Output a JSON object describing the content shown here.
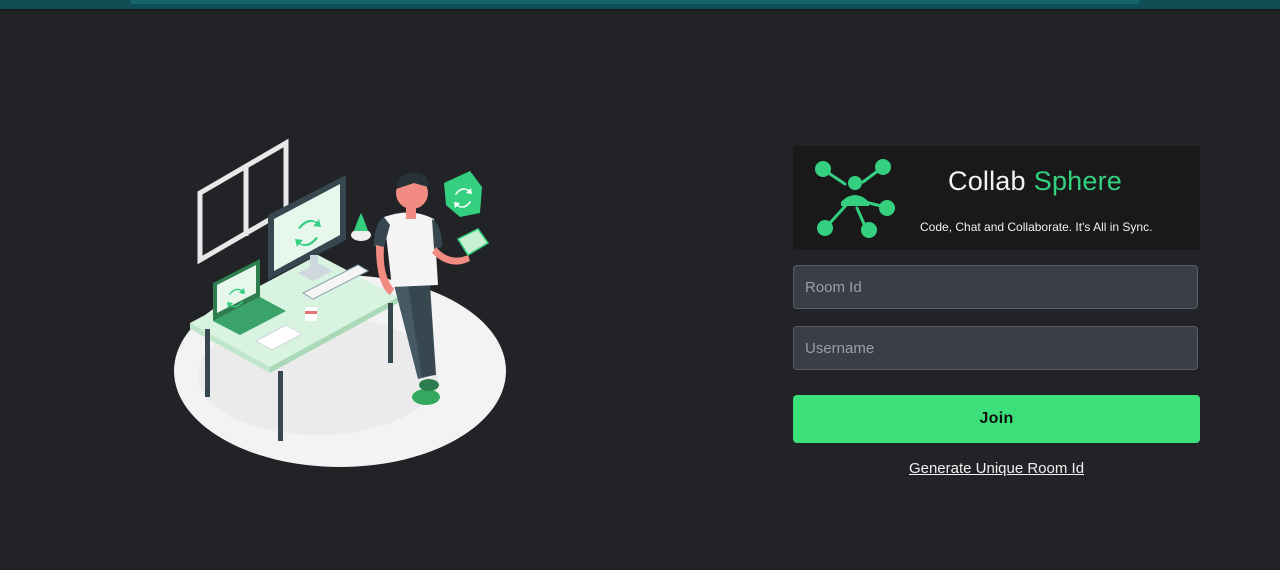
{
  "brand": {
    "name_part1": "Collab",
    "name_part2": "Sphere",
    "tagline": "Code, Chat and Collaborate. It's All in Sync.",
    "accent_color": "#35d07f",
    "logo_icon": "network-people-icon"
  },
  "form": {
    "room_id_placeholder": "Room Id",
    "room_id_value": "",
    "username_placeholder": "Username",
    "username_value": "",
    "join_label": "Join",
    "join_color": "#3be07a",
    "generate_link_label": "Generate Unique Room Id"
  },
  "illustration": {
    "subject": "person-at-desk-sync-illustration"
  },
  "theme": {
    "background": "#212327",
    "top_strip": "#0f4e55"
  }
}
